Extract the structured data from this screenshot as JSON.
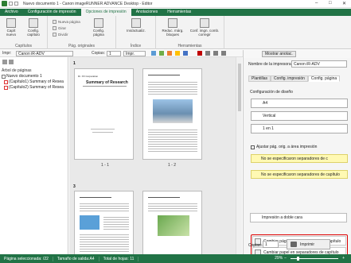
{
  "window": {
    "title": "Nuevo documento 1 - Canon imageRUNNER ADVANCE Desktop - Editor",
    "minimize": "–",
    "maximize": "□",
    "close": "✕"
  },
  "ribbon_tabs": [
    "Archivo",
    "Configuración de impresión",
    "Opciones de impresión",
    "Anotaciones",
    "Herramientas"
  ],
  "ribbon": {
    "groups": {
      "capitulos": "Capítulos",
      "pag_originales": "Pág. originales",
      "indice": "Índice",
      "herramientas": "Herramientas"
    },
    "buttons": {
      "capit_nuevo": "Capít nuevo",
      "config_capitulo": "Config. capítulo",
      "nueva_pagina": "Nueva página",
      "girar": "Girar",
      "dividir": "Dividir",
      "config_pagina": "Config. página",
      "ins_actualiz": "Ins/actualiz.",
      "reduc_marg": "Reduc. márg. bloques",
      "conf_imgn": "Conf. imgn. comb. corregir"
    }
  },
  "toolbar": {
    "printer_label": "Impr:",
    "printer_value": "Canon iR-ADV",
    "copies_label": "Copias:",
    "copies_value": "1",
    "mode_value": "Impr."
  },
  "left_panel": {
    "header": "Árbol de páginas",
    "tree": [
      {
        "label": "Nuevo documento 1"
      },
      {
        "label": "(Capítulo1) Summary of Resea"
      },
      {
        "label": "(Capítulo2) Summary of Resea"
      }
    ]
  },
  "pages": {
    "p1_num": "1",
    "p3_num": "3",
    "label_1_1": "1 - 1",
    "label_1_2": "1 - 2",
    "p1_heading": "Summary of Research",
    "p1_top": "Dr. XX Corporation"
  },
  "right_panel": {
    "show_annotations": "Mostrar anotac.",
    "printer_name_label": "Nombre de la impresora:",
    "printer_name_value": "Canon iR-ADV",
    "tabs": [
      "Plantillas",
      "Config. impresión",
      "Config. página"
    ],
    "layout_label": "Configuración de diseño",
    "paper": "A4",
    "orientation": "Vertical",
    "pages_per_sheet": "1 en 1",
    "fit_label": "Ajustar pág. orig. a área impresión",
    "chapter_sep_1": "No se especificaron separadores de c",
    "chapter_sep_2": "No se especificaron separadores de capítulo",
    "change_page_sep": "Cambiar página en separadores de capítulo",
    "change_paper_sep": "Cambiar papel en separadores de capítulo",
    "duplex": "Impresión a doble cara",
    "copies_label": "Copias:",
    "copies_value": "1",
    "print_button": "Imprimir"
  },
  "status": {
    "selected_page": "Página seleccionada: /22",
    "output_size": "Tamaño de salida:A4",
    "total_sheets": "Total de hojas: 11",
    "zoom": "29%"
  },
  "colors": {
    "accent": "#217346",
    "highlight": "#fff9b3",
    "focus": "#dd0000"
  }
}
